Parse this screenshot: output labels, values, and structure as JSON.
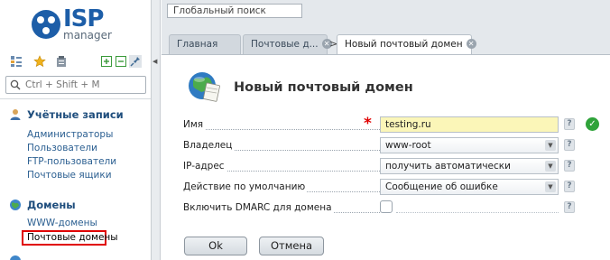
{
  "logo": {
    "brand": "ISP",
    "product": "manager"
  },
  "sidebar": {
    "search_placeholder": "Ctrl + Shift + M",
    "groups": [
      {
        "title": "Учётные записи",
        "items": [
          "Администраторы",
          "Пользователи",
          "FTP-пользователи",
          "Почтовые ящики"
        ]
      },
      {
        "title": "Домены",
        "items": [
          "WWW-домены",
          "Почтовые домены"
        ]
      }
    ],
    "active_item": "Почтовые домены"
  },
  "topbar": {
    "global_search_value": "Глобальный поиск",
    "tabs": [
      {
        "label": "Главная",
        "closable": false
      },
      {
        "label": "Почтовые д...",
        "closable": true
      },
      {
        "label": "Новый почтовый домен",
        "closable": true,
        "active": true
      }
    ],
    "tab_separator": ">"
  },
  "form": {
    "title": "Новый почтовый домен",
    "fields": [
      {
        "label": "Имя",
        "type": "input",
        "value": "testing.ru",
        "required": true,
        "valid": true
      },
      {
        "label": "Владелец",
        "type": "select",
        "value": "www-root"
      },
      {
        "label": "IP-адрес",
        "type": "select",
        "value": "получить автоматически"
      },
      {
        "label": "Действие по умолчанию",
        "type": "select",
        "value": "Сообщение об ошибке"
      },
      {
        "label": "Включить DMARC для домена",
        "type": "checkbox",
        "checked": false
      }
    ],
    "help_glyph": "?",
    "required_glyph": "*",
    "ok_label": "Ok",
    "cancel_label": "Отмена"
  },
  "colors": {
    "brand": "#1d5ea8",
    "required": "#e00000",
    "valid": "#2fa33a",
    "active_highlight": "#e00000",
    "input_bg": "#fbf6b8"
  }
}
